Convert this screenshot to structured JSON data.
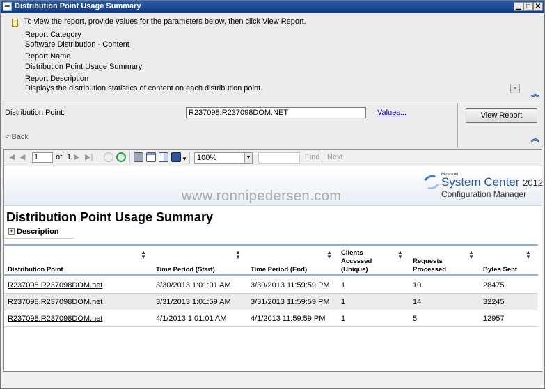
{
  "window": {
    "title": "Distribution Point Usage Summary"
  },
  "instructions": "To view the report, provide values for the parameters below, then click View Report.",
  "report_info": {
    "category_label": "Report Category",
    "category_value": "Software Distribution - Content",
    "name_label": "Report Name",
    "name_value": "Distribution Point Usage Summary",
    "description_label": "Report Description",
    "description_value": "Displays the distribution statistics of content on each distribution point."
  },
  "parameters": {
    "dp_label": "Distribution Point:",
    "dp_value": "R237098.R237098DOM.NET",
    "values_link": "Values...",
    "view_report": "View Report",
    "back": "< Back"
  },
  "toolbar": {
    "page": "1",
    "of_label": "of",
    "total_pages": "1",
    "zoom": "100%",
    "find": "Find",
    "next": "Next"
  },
  "banner": {
    "microsoft": "Microsoft",
    "product": "System Center",
    "year": "2012",
    "subproduct": "Configuration Manager",
    "watermark": "www.ronnipedersen.com"
  },
  "report": {
    "title": "Distribution Point Usage Summary",
    "description_toggle": "Description",
    "columns": [
      "Distribution Point",
      "Time Period (Start)",
      "Time Period (End)",
      "Clients Accessed (Unique)",
      "Requests Processed",
      "Bytes Sent"
    ],
    "rows": [
      [
        "R237098.R237098DOM.net",
        "3/30/2013 1:01:01 AM",
        "3/30/2013 11:59:59 PM",
        "1",
        "10",
        "28475"
      ],
      [
        "R237098.R237098DOM.net",
        "3/31/2013 1:01:59 AM",
        "3/31/2013 11:59:59 PM",
        "1",
        "14",
        "32245"
      ],
      [
        "R237098.R237098DOM.net",
        "4/1/2013 1:01:01 AM",
        "4/1/2013 11:59:59 PM",
        "1",
        "5",
        "12957"
      ]
    ]
  }
}
